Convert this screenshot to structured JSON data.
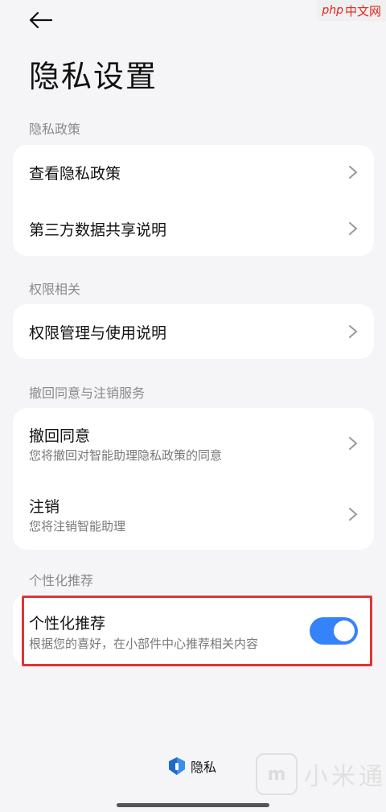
{
  "watermark_top": {
    "php": "php",
    "cn": "中文网"
  },
  "header": {
    "title": "隐私设置"
  },
  "sections": [
    {
      "label": "隐私政策",
      "items": [
        {
          "title": "查看隐私政策"
        },
        {
          "title": "第三方数据共享说明"
        }
      ]
    },
    {
      "label": "权限相关",
      "items": [
        {
          "title": "权限管理与使用说明"
        }
      ]
    },
    {
      "label": "撤回同意与注销服务",
      "items": [
        {
          "title": "撤回同意",
          "subtitle": "您将撤回对智能助理隐私政策的同意"
        },
        {
          "title": "注销",
          "subtitle": "您将注销智能助理"
        }
      ]
    },
    {
      "label": "个性化推荐",
      "items": [
        {
          "title": "个性化推荐",
          "subtitle": "根据您的喜好，在小部件中心推荐相关内容",
          "toggle_on": true
        }
      ]
    }
  ],
  "footer": {
    "brand": "隐私"
  },
  "watermark_bottom": {
    "logo": "m",
    "text": "小米通"
  },
  "colors": {
    "accent": "#3483fa",
    "highlight": "#e13535",
    "background": "#f5f5f7"
  }
}
